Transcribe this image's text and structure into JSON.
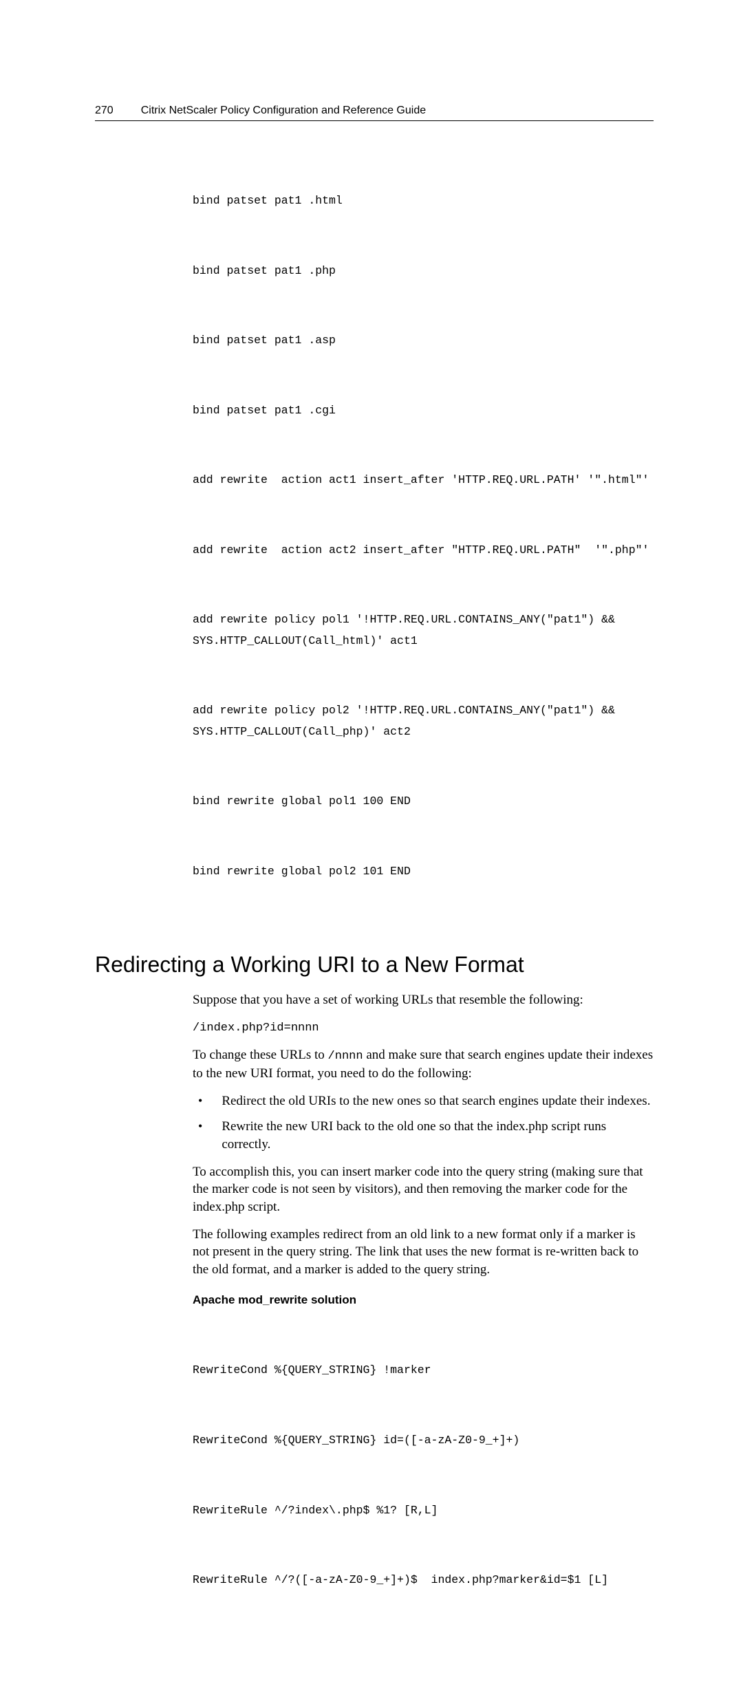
{
  "header": {
    "page_number": "270",
    "doc_title": "Citrix NetScaler Policy Configuration and Reference Guide"
  },
  "code1": {
    "l1": "bind patset pat1 .html",
    "l2": "bind patset pat1 .php",
    "l3": "bind patset pat1 .asp",
    "l4": "bind patset pat1 .cgi",
    "l5": "add rewrite  action act1 insert_after 'HTTP.REQ.URL.PATH' '\".html\"'",
    "l6": "add rewrite  action act2 insert_after \"HTTP.REQ.URL.PATH\"  '\".php\"'",
    "l7": "add rewrite policy pol1 '!HTTP.REQ.URL.CONTAINS_ANY(\"pat1\") && SYS.HTTP_CALLOUT(Call_html)' act1",
    "l8": "add rewrite policy pol2 '!HTTP.REQ.URL.CONTAINS_ANY(\"pat1\") && SYS.HTTP_CALLOUT(Call_php)' act2",
    "l9": "bind rewrite global pol1 100 END",
    "l10": "bind rewrite global pol2 101 END"
  },
  "heading": "Redirecting a Working URI to a New Format",
  "para1": "Suppose that you have a set of working URLs that resemble the following:",
  "code_inline1": "/index.php?id=nnnn",
  "para2_part1": "To change these URLs to ",
  "para2_mono": "/nnnn",
  "para2_part2": " and make sure that search engines update their indexes to the new URI format, you need to do the following:",
  "bullets": {
    "b1": "Redirect the old URIs to the new ones so that search engines update their indexes.",
    "b2": "Rewrite the new URI back to the old one so that the index.php script runs correctly."
  },
  "para3": "To accomplish this, you can insert marker code into the query string (making sure that the marker code is not seen by visitors), and then removing the marker code for the index.php script.",
  "para4": "The following examples redirect from an old link to a new format only if a marker is not present in the query string. The link that uses the new format is re-written back to the old format, and a marker is added to the query string.",
  "subheading": "Apache mod_rewrite solution",
  "code2": {
    "l1": "RewriteCond %{QUERY_STRING} !marker",
    "l2": "RewriteCond %{QUERY_STRING} id=([-a-zA-Z0-9_+]+)",
    "l3": "RewriteRule ^/?index\\.php$ %1? [R,L]",
    "l4": "RewriteRule ^/?([-a-zA-Z0-9_+]+)$  index.php?marker&id=$1 [L]"
  }
}
